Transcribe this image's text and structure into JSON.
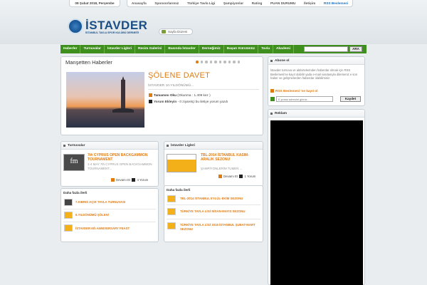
{
  "header": {
    "date": "08 Şubat 2018, Perşembe",
    "topnav": [
      "Anasayfa",
      "Sponsorlarımız",
      "Türkiye Tavla Ligi",
      "Şampiyonlar",
      "Rating",
      "PUAN DURUMU",
      "İletişim",
      "RSS Beslemesi"
    ],
    "logo_title": "İSTAVDER",
    "logo_subtitle": "İSTANBUL TAVLA SPOR KULÜBÜ DERNEĞİ",
    "home_button": "Sayfa Düzeni"
  },
  "mainnav": {
    "items": [
      "Haberler",
      "Turnuvalar",
      "İstavder Ligleri",
      "Resim Galerisi",
      "Basında İstavder",
      "Derneğimiz",
      "Başarı Kürsümüz",
      "Tavla",
      "Akademi"
    ],
    "search_placeholder": "",
    "search_button": "ARA"
  },
  "manset": {
    "title": "Manşetten Haberler",
    "dot_count": 10,
    "active_dot": 0,
    "headline": "ŞÖLENE DAVET",
    "subtitle": "İSTAVDER 10.YILDÖNÜMÜ...",
    "read_more": "Tamamını Oku",
    "read_count": "(Okunma : 1.409 kez )",
    "comment_add": "Yorum Ekleyin",
    "comment_rest": "- 0 ziyaretçi bu iletiye yorum yazdı"
  },
  "turnuvalar": {
    "title": "Turnuvalar",
    "item_title": "7th CYPRUS OPEN BACKGAMMON TOURNAMENT",
    "item_desc": "1-4 MAY 7th CYPRUS OPEN BACKGAMMON TOURNAMENT...",
    "more": "Devamı Et",
    "comments": "4 Yorum"
  },
  "istavder_ligleri": {
    "title": "İstavder Ligleri",
    "item_title": "TBL-2014 İSTANBUL KASIM-ARALIK SEZONU",
    "item_desc": "ŞAMPİYONLERİM TUMEN ...",
    "more": "Devamı Et",
    "comments": "1 Yorum"
  },
  "more_left": {
    "title": "Daha fazla ilerli",
    "links": [
      "7.KIBRIS AÇIK TAVLA TURNUVASI",
      "6.YILDÖNÜMÜ ŞÖLENİ",
      "İSTAVDER 6th ANNIVERSARY FEAST"
    ]
  },
  "more_right": {
    "title": "Daha fazla ilerli",
    "links": [
      "TBL-2014 İSTANBUL EYLÜL-EKİM SEZONU",
      "TÜRKİYE TAVLA LİGİ NİSAN-MAYIS SEZONU",
      "TÜRKİYE TAVLA LİGİ 2016 İSTANBUL ŞUBAT-MART SEZONU"
    ]
  },
  "abone": {
    "title": "Abone ol",
    "text": "İstavder turnuva ve aktivitelerinden haberdar olmak için RSS Beslemesi'ne kayıt olabilir yada e-mail vasıtasıyla dilerseniz e son haber ve gelişmelerden haberdar olabilirsiniz.",
    "rss_link": "RSS Beslemesi 'ne kayıt ol",
    "email_placeholder": "E-posta adresini giriniz..",
    "save": "Kaydet"
  },
  "reklam": {
    "title": "Reklam"
  },
  "colors": {
    "nav": "#3f8f1e",
    "accent": "#e07b12",
    "brand": "#1a4f86"
  }
}
